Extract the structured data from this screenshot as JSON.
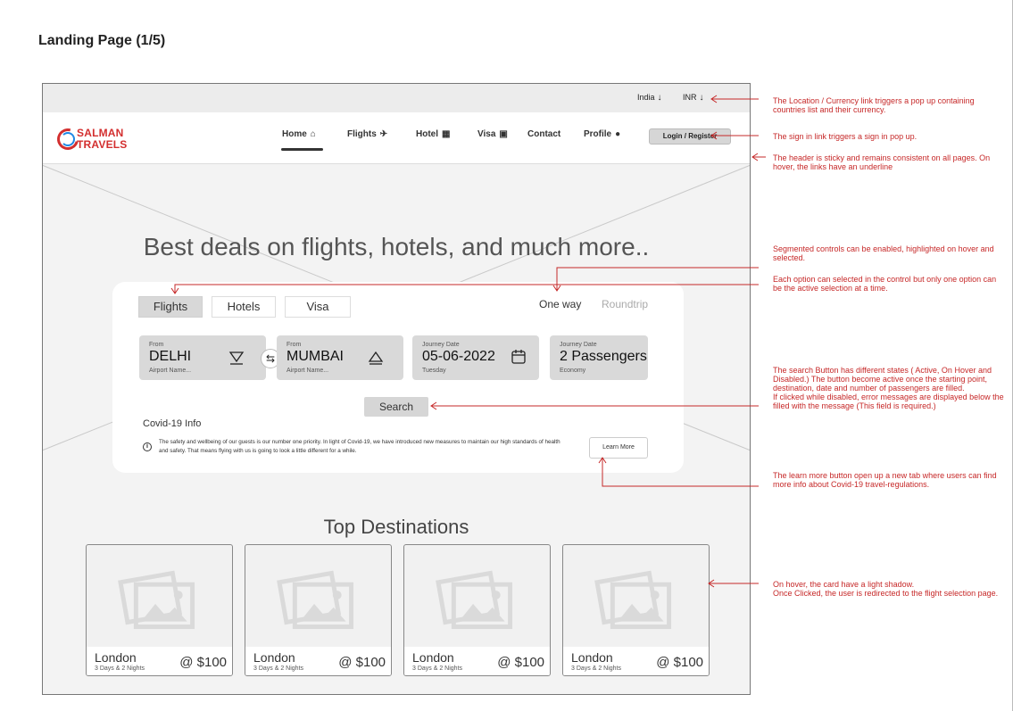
{
  "page_title": "Landing Page (1/5)",
  "topbar": {
    "country": "India",
    "currency": "INR"
  },
  "brand": {
    "line1": "SALMAN",
    "line2": "TRAVELS"
  },
  "nav": {
    "home": "Home",
    "flights": "Flights",
    "hotel": "Hotel",
    "visa": "Visa",
    "contact": "Contact",
    "profile": "Profile",
    "login": "Login / Register"
  },
  "hero": {
    "title": "Best deals on flights, hotels, and much more.."
  },
  "search": {
    "tabs": [
      "Flights",
      "Hotels",
      "Visa"
    ],
    "active_tab": "Flights",
    "trip_types": [
      "One way",
      "Roundtrip"
    ],
    "active_trip": "One way",
    "from": {
      "label": "From",
      "value": "DELHI",
      "sub": "Airport Name..."
    },
    "to": {
      "label": "From",
      "value": "MUMBAI",
      "sub": "Airport Name..."
    },
    "date": {
      "label": "Journey Date",
      "value": "05-06-2022",
      "sub": "Tuesday"
    },
    "passengers": {
      "label": "Journey Date",
      "value": "2 Passengers",
      "sub": "Economy"
    },
    "button": "Search"
  },
  "covid": {
    "title": "Covid-19 Info",
    "text": "The safety and wellbeing of our guests is our number one priority. In light of Covid-19, we have introduced new measures to maintain our high standards of health and safety. That means flying with us is going to look a little different for a while.",
    "button": "Learn More"
  },
  "destinations": {
    "title": "Top Destinations",
    "cards": [
      {
        "city": "London",
        "duration": "3 Days & 2 Nights",
        "price": "@ $100"
      },
      {
        "city": "London",
        "duration": "3 Days & 2 Nights",
        "price": "@ $100"
      },
      {
        "city": "London",
        "duration": "3 Days & 2 Nights",
        "price": "@ $100"
      },
      {
        "city": "London",
        "duration": "3 Days & 2 Nights",
        "price": "@ $100"
      }
    ]
  },
  "annotations": {
    "location": "The Location / Currency link triggers a pop up containing countries list and their currency.",
    "signin": "The sign in link triggers a sign in pop up.",
    "header": "The header is sticky and remains consistent on all pages. On hover, the links have an underline",
    "segmented": "Segmented controls can be enabled, highlighted on hover and selected.",
    "option": "Each option can selected in the control but only one option can be the active selection at a time.",
    "search": "The search Button has different states ( Active, On Hover and Disabled.) The button become active once the starting point, destination, date and number of passengers are filled.\nIf clicked while disabled, error messages are displayed below the filled with the message (This field is required.)",
    "learn": "The learn more button open up a new tab where users can find more info about Covid-19 travel-regulations.",
    "card": "On hover, the card have a light shadow.\nOnce Clicked, the user is redirected to the flight selection page."
  },
  "colors": {
    "annotation": "#c62828",
    "brand": "#d32f2f"
  }
}
